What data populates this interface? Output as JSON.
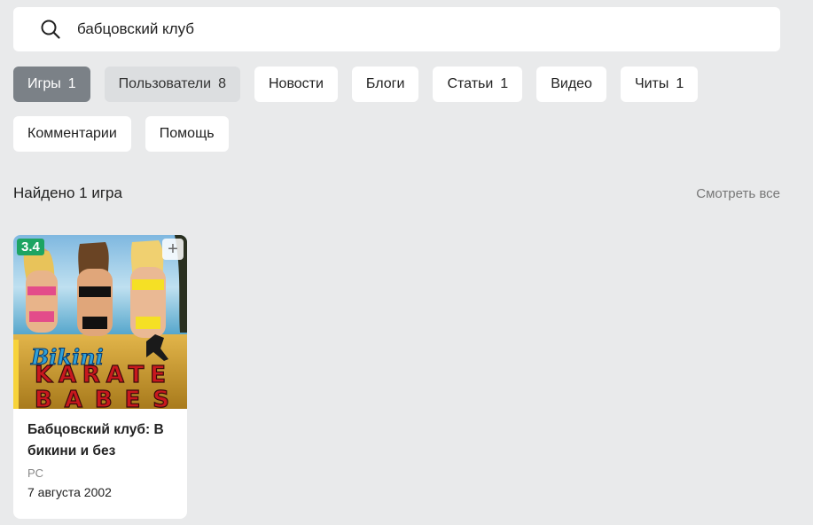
{
  "search": {
    "value": "бабцовский клуб",
    "icon": "search-icon"
  },
  "filters": [
    {
      "label": "Игры",
      "count": "1",
      "state": "active"
    },
    {
      "label": "Пользователи",
      "count": "8",
      "state": "muted"
    },
    {
      "label": "Новости",
      "count": "",
      "state": "normal"
    },
    {
      "label": "Блоги",
      "count": "",
      "state": "normal"
    },
    {
      "label": "Статьи",
      "count": "1",
      "state": "normal"
    },
    {
      "label": "Видео",
      "count": "",
      "state": "normal"
    },
    {
      "label": "Читы",
      "count": "1",
      "state": "normal"
    },
    {
      "label": "Комментарии",
      "count": "",
      "state": "normal"
    },
    {
      "label": "Помощь",
      "count": "",
      "state": "normal"
    }
  ],
  "results": {
    "found_text": "Найдено 1 игра",
    "see_all": "Смотреть все"
  },
  "game": {
    "rating": "3.4",
    "title": "Бабцовский клуб: В бикини и без",
    "platform": "PC",
    "date": "7 августа 2002",
    "cover_text_1": "Bikini",
    "cover_text_2": "KARATE",
    "cover_text_3": "BABES",
    "rating_color": "#1da462"
  }
}
